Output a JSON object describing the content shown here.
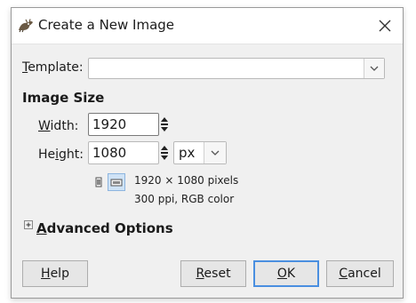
{
  "window": {
    "title": "Create a New Image",
    "close_label": "×"
  },
  "template": {
    "label_prefix": "",
    "label_mnemonic": "T",
    "label_rest": "emplate:",
    "value": ""
  },
  "image_size": {
    "title": "Image Size",
    "width_label_mnemonic": "W",
    "width_label_rest": "idth:",
    "width_value": "1920",
    "height_label_pre": "He",
    "height_label_mnemonic": "i",
    "height_label_rest": "ght:",
    "height_value": "1080",
    "unit": "px",
    "info_dimensions": "1920 × 1080 pixels",
    "info_resolution": "300 ppi, RGB color"
  },
  "advanced": {
    "mnemonic": "A",
    "rest": "dvanced Options"
  },
  "buttons": {
    "help_mnemonic": "H",
    "help_rest": "elp",
    "reset_mnemonic": "R",
    "reset_rest": "eset",
    "ok_mnemonic": "O",
    "ok_rest": "K",
    "cancel_mnemonic": "C",
    "cancel_rest": "ancel"
  },
  "colors": {
    "default_button_border": "#4a8fe0",
    "dialog_background": "#f0f0f0"
  }
}
